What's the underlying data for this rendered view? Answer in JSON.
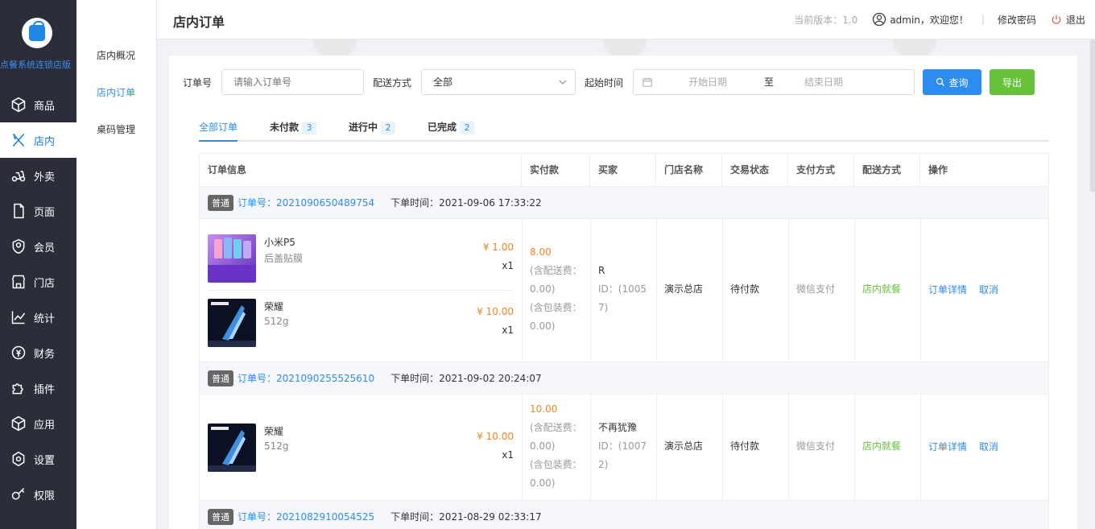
{
  "app": {
    "title": "点餐系统连锁店版",
    "version_text": "当前版本：1.0",
    "user_greeting": "admin，欢迎您！",
    "change_password": "修改密码",
    "logout": "退出"
  },
  "sidebar": {
    "items": [
      {
        "label": "商品",
        "icon": "cube-icon"
      },
      {
        "label": "店内",
        "icon": "utensils-icon"
      },
      {
        "label": "外卖",
        "icon": "scooter-icon"
      },
      {
        "label": "页面",
        "icon": "page-icon"
      },
      {
        "label": "会员",
        "icon": "member-icon"
      },
      {
        "label": "门店",
        "icon": "store-icon"
      },
      {
        "label": "统计",
        "icon": "chart-icon"
      },
      {
        "label": "财务",
        "icon": "finance-icon"
      },
      {
        "label": "插件",
        "icon": "puzzle-icon"
      },
      {
        "label": "应用",
        "icon": "box-icon"
      },
      {
        "label": "设置",
        "icon": "settings-icon"
      },
      {
        "label": "权限",
        "icon": "key-icon"
      }
    ],
    "active": 1
  },
  "subnav": {
    "items": [
      "店内概况",
      "店内订单",
      "桌码管理"
    ]
  },
  "page": {
    "title": "店内订单"
  },
  "filter": {
    "order_no_label": "订单号",
    "order_no_placeholder": "请输入订单号",
    "delivery_label": "配送方式",
    "delivery_value": "全部",
    "time_label": "起始时间",
    "start_placeholder": "开始日期",
    "range_sep": "至",
    "end_placeholder": "结束日期",
    "query_button": "查询",
    "export_button": "导出"
  },
  "tabs": [
    {
      "label": "全部订单",
      "count": ""
    },
    {
      "label": "未付款",
      "count": "3"
    },
    {
      "label": "进行中",
      "count": "2"
    },
    {
      "label": "已完成",
      "count": "2"
    }
  ],
  "table": {
    "headers": [
      "订单信息",
      "实付款",
      "买家",
      "门店名称",
      "交易状态",
      "支付方式",
      "配送方式",
      "操作"
    ],
    "orders": [
      {
        "tag": "普通",
        "order_no": "订单号：2021090650489754",
        "order_time": "下单时间：2021-09-06 17:33:22",
        "items": [
          {
            "name": "小米P5",
            "spec": "后盖贴膜",
            "price": "¥ 1.00",
            "qty": "x1"
          },
          {
            "name": "荣耀",
            "spec": "512g",
            "price": "¥ 10.00",
            "qty": "x1"
          }
        ],
        "paid": "8.00",
        "delivery_fee": "(含配送费：",
        "delivery_fee_val": "0.00)",
        "pack_fee": "(含包装费：",
        "pack_fee_val": "0.00)",
        "buyer": "R",
        "buyer_id_1": "ID：(1005",
        "buyer_id_2": "7)",
        "store": "演示总店",
        "status": "待付款",
        "pay_method": "微信支付",
        "delivery": "店内就餐",
        "action_detail": "订单详情",
        "action_cancel": "取消"
      },
      {
        "tag": "普通",
        "order_no": "订单号：2021090255525610",
        "order_time": "下单时间：2021-09-02 20:24:07",
        "items": [
          {
            "name": "荣耀",
            "spec": "512g",
            "price": "¥ 10.00",
            "qty": "x1"
          }
        ],
        "paid": "10.00",
        "delivery_fee": "(含配送费：",
        "delivery_fee_val": "0.00)",
        "pack_fee": "(含包装费：",
        "pack_fee_val": "0.00)",
        "buyer": "不再犹豫",
        "buyer_id_1": "ID：(1007",
        "buyer_id_2": "2)",
        "store": "演示总店",
        "status": "待付款",
        "pay_method": "微信支付",
        "delivery": "店内就餐",
        "action_detail": "订单详情",
        "action_cancel": "取消"
      },
      {
        "tag": "普通",
        "order_no": "订单号：2021082910054525",
        "order_time": "下单时间：2021-08-29 02:33:17"
      }
    ]
  },
  "colors": {
    "sidebar_bg": "#2b2d38",
    "accent": "#2d8cf0",
    "price": "#f5861f",
    "success": "#67c23a"
  }
}
